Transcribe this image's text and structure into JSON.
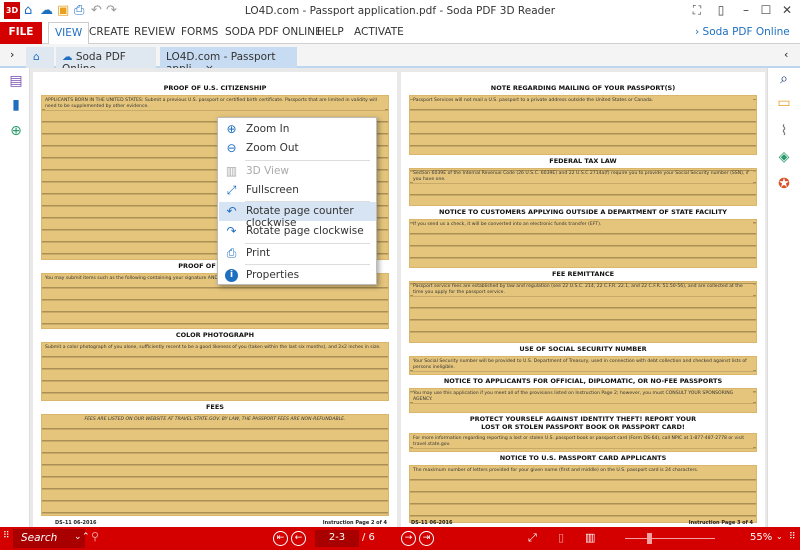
{
  "app": {
    "title": "LO4D.com - Passport application.pdf   -   Soda PDF 3D Reader",
    "logo": "3D"
  },
  "quick_access": [
    "home-icon",
    "cloud-icon",
    "open-folder-icon",
    "print-icon",
    "undo-icon",
    "redo-icon"
  ],
  "menu": {
    "file": "FILE",
    "items": [
      "VIEW",
      "CREATE",
      "REVIEW",
      "FORMS",
      "SODA PDF ONLINE",
      "HELP",
      "ACTIVATE"
    ],
    "online_link": "Soda PDF Online"
  },
  "tabs": {
    "cloud_tab": "Soda PDF Online",
    "doc_tab": "LO4D.com - Passport appli...",
    "close": "×"
  },
  "context_menu": {
    "items": [
      {
        "label": "Zoom In",
        "icon": "zoom-in-icon",
        "enabled": true
      },
      {
        "label": "Zoom Out",
        "icon": "zoom-out-icon",
        "enabled": true
      },
      {
        "label": "3D View",
        "icon": "3d-view-icon",
        "enabled": false
      },
      {
        "label": "Fullscreen",
        "icon": "fullscreen-icon",
        "enabled": true
      },
      {
        "label": "Rotate page counter clockwise",
        "icon": "rotate-ccw-icon",
        "enabled": true,
        "highlighted": true
      },
      {
        "label": "Rotate page clockwise",
        "icon": "rotate-cw-icon",
        "enabled": true
      },
      {
        "label": "Print",
        "icon": "print-icon",
        "enabled": true
      },
      {
        "label": "Properties",
        "icon": "info-icon",
        "enabled": true
      }
    ]
  },
  "left_page": {
    "sections": [
      {
        "heading": "PROOF OF U.S. CITIZENSHIP",
        "text": "APPLICANTS BORN IN THE UNITED STATES: Submit a previous U.S. passport or certified birth certificate. Passports that are limited in validity will need to be supplemented by other evidence."
      },
      {
        "heading": "PROOF OF IDENTITY",
        "text": "You may submit items such as the following containing your signature AND a photograph that is a good likeness of you."
      },
      {
        "heading": "COLOR PHOTOGRAPH",
        "text": "Submit a color photograph of you alone, sufficiently recent to be a good likeness of you (taken within the last six months), and 2x2 inches in size."
      },
      {
        "heading": "FEES",
        "text": "FEES ARE LISTED ON OUR WEBSITE AT TRAVEL.STATE.GOV. BY LAW, THE PASSPORT FEES ARE NON-REFUNDABLE."
      }
    ],
    "footer_left": "DS-11  06-2016",
    "footer_right": "Instruction Page 2 of 4"
  },
  "right_page": {
    "sections": [
      {
        "heading": "NOTE REGARDING MAILING OF YOUR PASSPORT(S)",
        "text": "Passport Services will not mail a U.S. passport to a private address outside the United States or Canada."
      },
      {
        "heading": "FEDERAL TAX LAW",
        "text": "Section 6039E of the Internal Revenue Code (26 U.S.C. 6039E) and 22 U.S.C 2714a(f) require you to provide your Social Security number (SSN), if you have one."
      },
      {
        "heading": "NOTICE TO CUSTOMERS APPLYING OUTSIDE A DEPARTMENT OF STATE FACILITY",
        "text": "If you send us a check, it will be converted into an electronic funds transfer (EFT)."
      },
      {
        "heading": "FEE REMITTANCE",
        "text": "Passport service fees are established by law and regulation (see 22 U.S.C. 214, 22 C.F.R. 22.1, and 22 C.F.R. 51.50-56), and are collected at the time you apply for the passport service."
      },
      {
        "heading": "USE OF SOCIAL SECURITY NUMBER",
        "text": "Your Social Security number will be provided to U.S. Department of Treasury, used in connection with debt collection and checked against lists of persons ineligible."
      },
      {
        "heading": "NOTICE TO APPLICANTS FOR OFFICIAL, DIPLOMATIC, OR NO-FEE PASSPORTS",
        "text": "You may use this application if you meet all of the provisions listed on Instruction Page 2; however, you must CONSULT YOUR SPONSORING AGENCY."
      },
      {
        "heading": "PROTECT YOURSELF AGAINST IDENTITY THEFT! REPORT YOUR LOST OR STOLEN PASSPORT BOOK OR PASSPORT CARD!",
        "text": "For more information regarding reporting a lost or stolen U.S. passport book or passport card (Form DS-64), call NPIC at 1-877-487-2778 or visit travel.state.gov."
      },
      {
        "heading": "NOTICE TO U.S. PASSPORT CARD APPLICANTS",
        "text": "The maximum number of letters provided for your given name (first and middle) on the U.S. passport card is 24 characters."
      }
    ],
    "footer_left": "DS-11  06-2016",
    "footer_right": "Instruction Page 3 of 4"
  },
  "left_sidebar": [
    "thumbnails-icon",
    "bookmarks-icon",
    "links-icon"
  ],
  "right_sidebar": [
    "find-icon",
    "comments-icon",
    "attachments-icon",
    "layers-icon",
    "certificate-icon"
  ],
  "bottom": {
    "search_placeholder": "Search",
    "page_input": "2-3",
    "page_total": "/ 6",
    "zoom": "55%"
  },
  "colors": {
    "accent_red": "#d40000",
    "highlight": "#e5c57c",
    "link_blue": "#1e6fc0"
  }
}
